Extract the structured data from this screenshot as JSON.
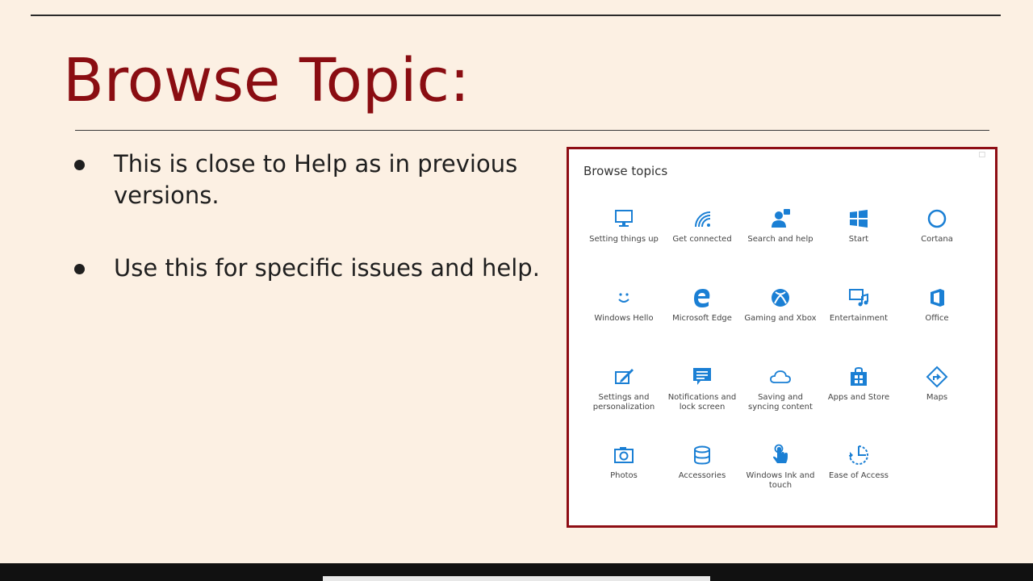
{
  "slide": {
    "title": "Browse Topic:",
    "bullets": [
      "This is close to Help as in previous versions.",
      "Use this for specific issues and help."
    ]
  },
  "panel": {
    "title": "Browse topics",
    "accent_color": "#1a7fd4",
    "topics": [
      {
        "label": "Setting things up",
        "icon": "monitor-icon"
      },
      {
        "label": "Get connected",
        "icon": "wifi-icon"
      },
      {
        "label": "Search and help",
        "icon": "person-help-icon"
      },
      {
        "label": "Start",
        "icon": "windows-logo-icon"
      },
      {
        "label": "Cortana",
        "icon": "circle-icon"
      },
      {
        "label": "Windows Hello",
        "icon": "smile-icon"
      },
      {
        "label": "Microsoft Edge",
        "icon": "edge-icon"
      },
      {
        "label": "Gaming and Xbox",
        "icon": "xbox-icon"
      },
      {
        "label": "Entertainment",
        "icon": "media-icon"
      },
      {
        "label": "Office",
        "icon": "office-icon"
      },
      {
        "label": "Settings and personalization",
        "icon": "pen-edit-icon"
      },
      {
        "label": "Notifications and lock screen",
        "icon": "notification-icon"
      },
      {
        "label": "Saving and syncing content",
        "icon": "cloud-icon"
      },
      {
        "label": "Apps and Store",
        "icon": "store-bag-icon"
      },
      {
        "label": "Maps",
        "icon": "map-directions-icon"
      },
      {
        "label": "Photos",
        "icon": "camera-icon"
      },
      {
        "label": "Accessories",
        "icon": "database-icon"
      },
      {
        "label": "Windows Ink and touch",
        "icon": "touch-hand-icon"
      },
      {
        "label": "Ease of Access",
        "icon": "ease-of-access-icon"
      }
    ]
  }
}
